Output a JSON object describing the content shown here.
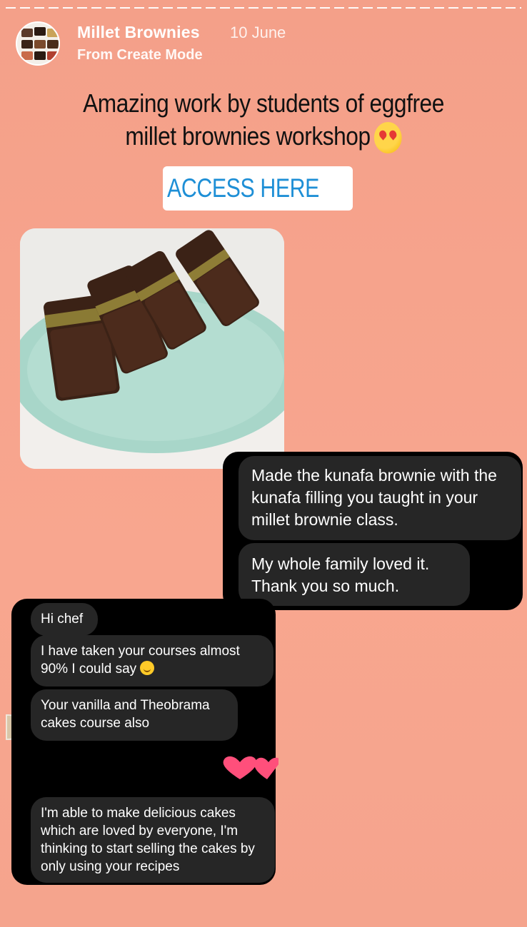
{
  "story": {
    "account_name": "Millet Brownies",
    "date": "10 June",
    "source": "From Create Mode",
    "caption_line1": "Amazing work by students of eggfree",
    "caption_line2": "millet brownies workshop",
    "caption_emoji": "star-struck-emoji",
    "link_sticker_label": "ACCESS HERE",
    "link_icon": "link-icon",
    "photo": "brownie-bars-on-plate-photo"
  },
  "chat_right": {
    "messages": [
      "Made the kunafa brownie with the kunafa filling you taught in your millet brownie class.",
      "My whole family loved it. Thank you so much."
    ]
  },
  "chat_left": {
    "messages": [
      "Hi chef",
      "I have taken your courses almost 90% I could say",
      "Your vanilla and Theobrama cakes course also",
      "I'm able to make delicious cakes which are loved by everyone, I'm thinking to start selling the cakes by only using your recipes"
    ],
    "emoji_after_message_2": "smiling-face-emoji",
    "reaction": "hearts-icon"
  },
  "colors": {
    "background": "#f7a48c",
    "link": "#1e8fd6",
    "chat_background": "#000000",
    "bubble": "#262626"
  }
}
